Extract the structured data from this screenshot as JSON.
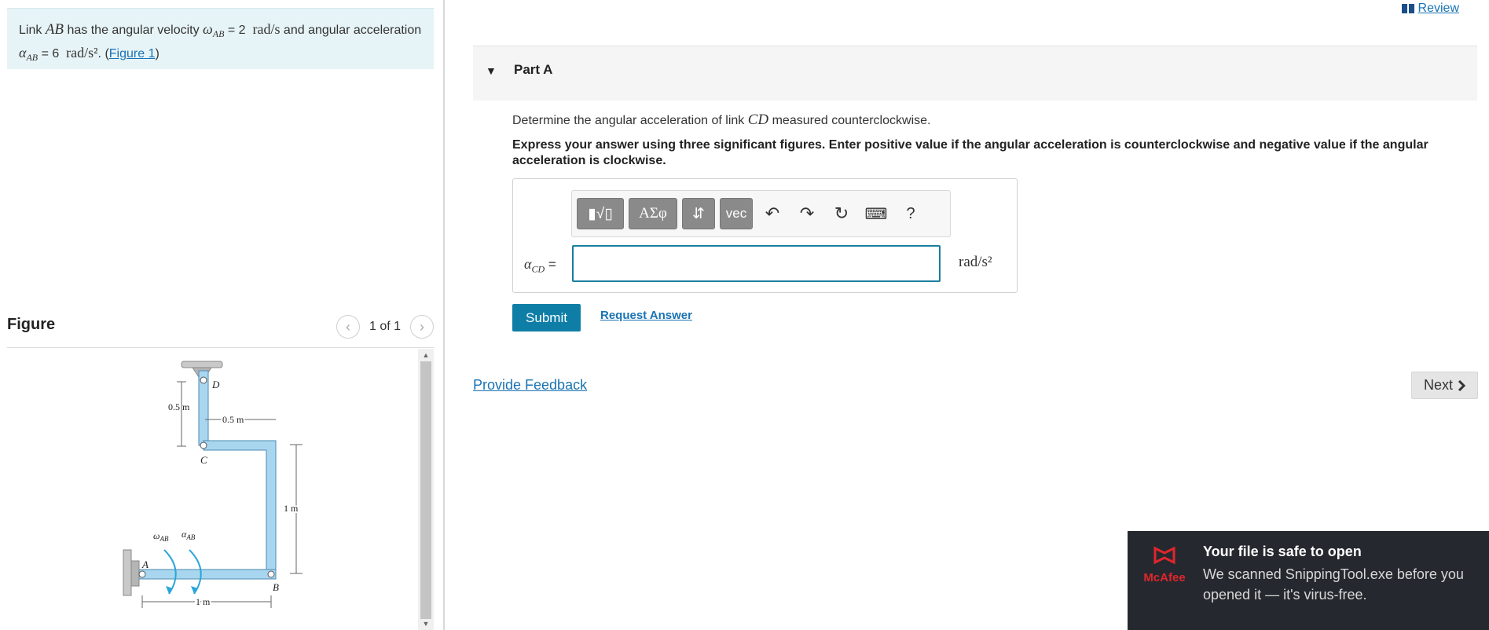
{
  "problem": {
    "link_text": "Link",
    "link_name": "AB",
    "velocity_text": "has the angular velocity",
    "omega_symbol": "ω",
    "omega_sub": "AB",
    "omega_value": "= 2",
    "omega_unit": "rad/s",
    "accel_text_prefix": "and angular acceleration",
    "alpha_symbol": "α",
    "alpha_sub": "AB",
    "alpha_value": "= 6",
    "alpha_unit": "rad/s²",
    "figure_link_open": ". (",
    "figure_link": "Figure 1",
    "figure_link_close": ")"
  },
  "figure_panel": {
    "title": "Figure",
    "pager_prev": "‹",
    "pager_text": "1 of 1",
    "pager_next": "›",
    "diagram": {
      "label_D": "D",
      "label_C": "C",
      "label_A": "A",
      "label_B": "B",
      "dim_05_vertical": "0.5 m",
      "dim_05_horizontal": "0.5 m",
      "dim_1_vertical": "1 m",
      "dim_1_horizontal": "1 m",
      "omega_label": "ω",
      "omega_sub": "AB",
      "alpha_label": "α",
      "alpha_sub": "AB"
    }
  },
  "header": {
    "review_label": "Review"
  },
  "part": {
    "title": "Part A",
    "question_prefix": "Determine the angular acceleration of link",
    "question_link": "CD",
    "question_suffix": "measured counterclockwise.",
    "instructions": "Express your answer using three significant figures. Enter positive value if the angular acceleration is counterclockwise and negative value if the angular acceleration is clockwise."
  },
  "toolbar": {
    "templates": "▮√▯",
    "greek": "ΑΣφ",
    "arrows": "⇵",
    "vec": "vec",
    "undo": "↶",
    "redo": "↷",
    "reset": "↻",
    "keyboard": "⌨",
    "help": "?"
  },
  "answer": {
    "label_symbol": "α",
    "label_sub": "CD",
    "label_eq": "=",
    "value": "",
    "unit": "rad/s²"
  },
  "actions": {
    "submit": "Submit",
    "request_answer": "Request Answer",
    "provide_feedback": "Provide Feedback",
    "next": "Next"
  },
  "toast": {
    "brand": "McAfee",
    "title": "Your file is safe to open",
    "body": "We scanned SnippingTool.exe before you opened it — it's virus-free."
  }
}
